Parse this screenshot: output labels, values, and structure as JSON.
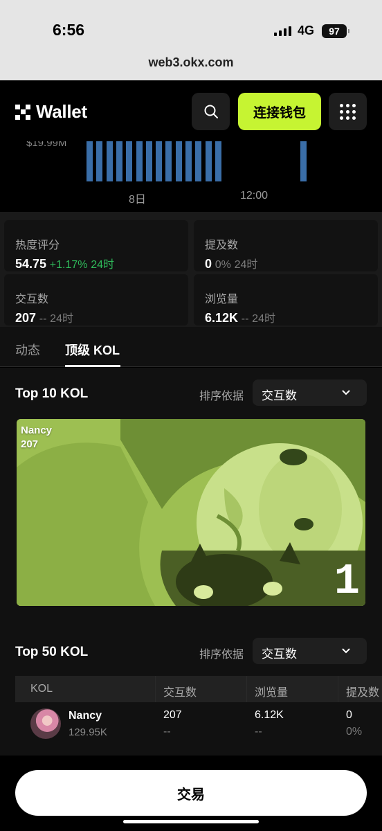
{
  "status_bar": {
    "time": "6:56",
    "network": "4G",
    "battery": "97"
  },
  "browser": {
    "url": "web3.okx.com"
  },
  "header": {
    "logo_text": "Wallet",
    "connect_label": "连接钱包",
    "search_icon": "search-icon",
    "menu_icon": "grid-menu-icon",
    "accent_color": "#c6f432"
  },
  "chart_data": {
    "type": "bar",
    "ytick_visible": "$19.99M",
    "xticks": [
      "8日",
      "12:00"
    ],
    "bar_color": "#3a6ea8"
  },
  "stats": [
    {
      "label": "热度评分",
      "value": "54.75",
      "change": "+1.17%",
      "period": "24时",
      "trend": "up"
    },
    {
      "label": "提及数",
      "value": "0",
      "change": "0%",
      "period": "24时",
      "trend": "flat"
    },
    {
      "label": "交互数",
      "value": "207",
      "change": "--",
      "period": "24时",
      "trend": "flat"
    },
    {
      "label": "浏览量",
      "value": "6.12K",
      "change": "--",
      "period": "24时",
      "trend": "flat"
    }
  ],
  "tabs": [
    {
      "label": "动态",
      "active": false
    },
    {
      "label": "顶级 KOL",
      "active": true
    }
  ],
  "top10": {
    "title": "Top 10 KOL",
    "sort_label": "排序依据",
    "sort_value": "交互数",
    "card": {
      "name": "Nancy",
      "score": "207",
      "rank": "1"
    }
  },
  "top50": {
    "title": "Top 50 KOL",
    "sort_label": "排序依据",
    "sort_value": "交互数",
    "columns": [
      "KOL",
      "交互数",
      "浏览量",
      "提及数"
    ],
    "rows": [
      {
        "name": "Nancy",
        "followers": "129.95K",
        "interactions": "207",
        "interactions_chg": "--",
        "views": "6.12K",
        "views_chg": "--",
        "mentions": "0",
        "mentions_chg": "0%"
      }
    ]
  },
  "footer": {
    "trade_label": "交易"
  }
}
